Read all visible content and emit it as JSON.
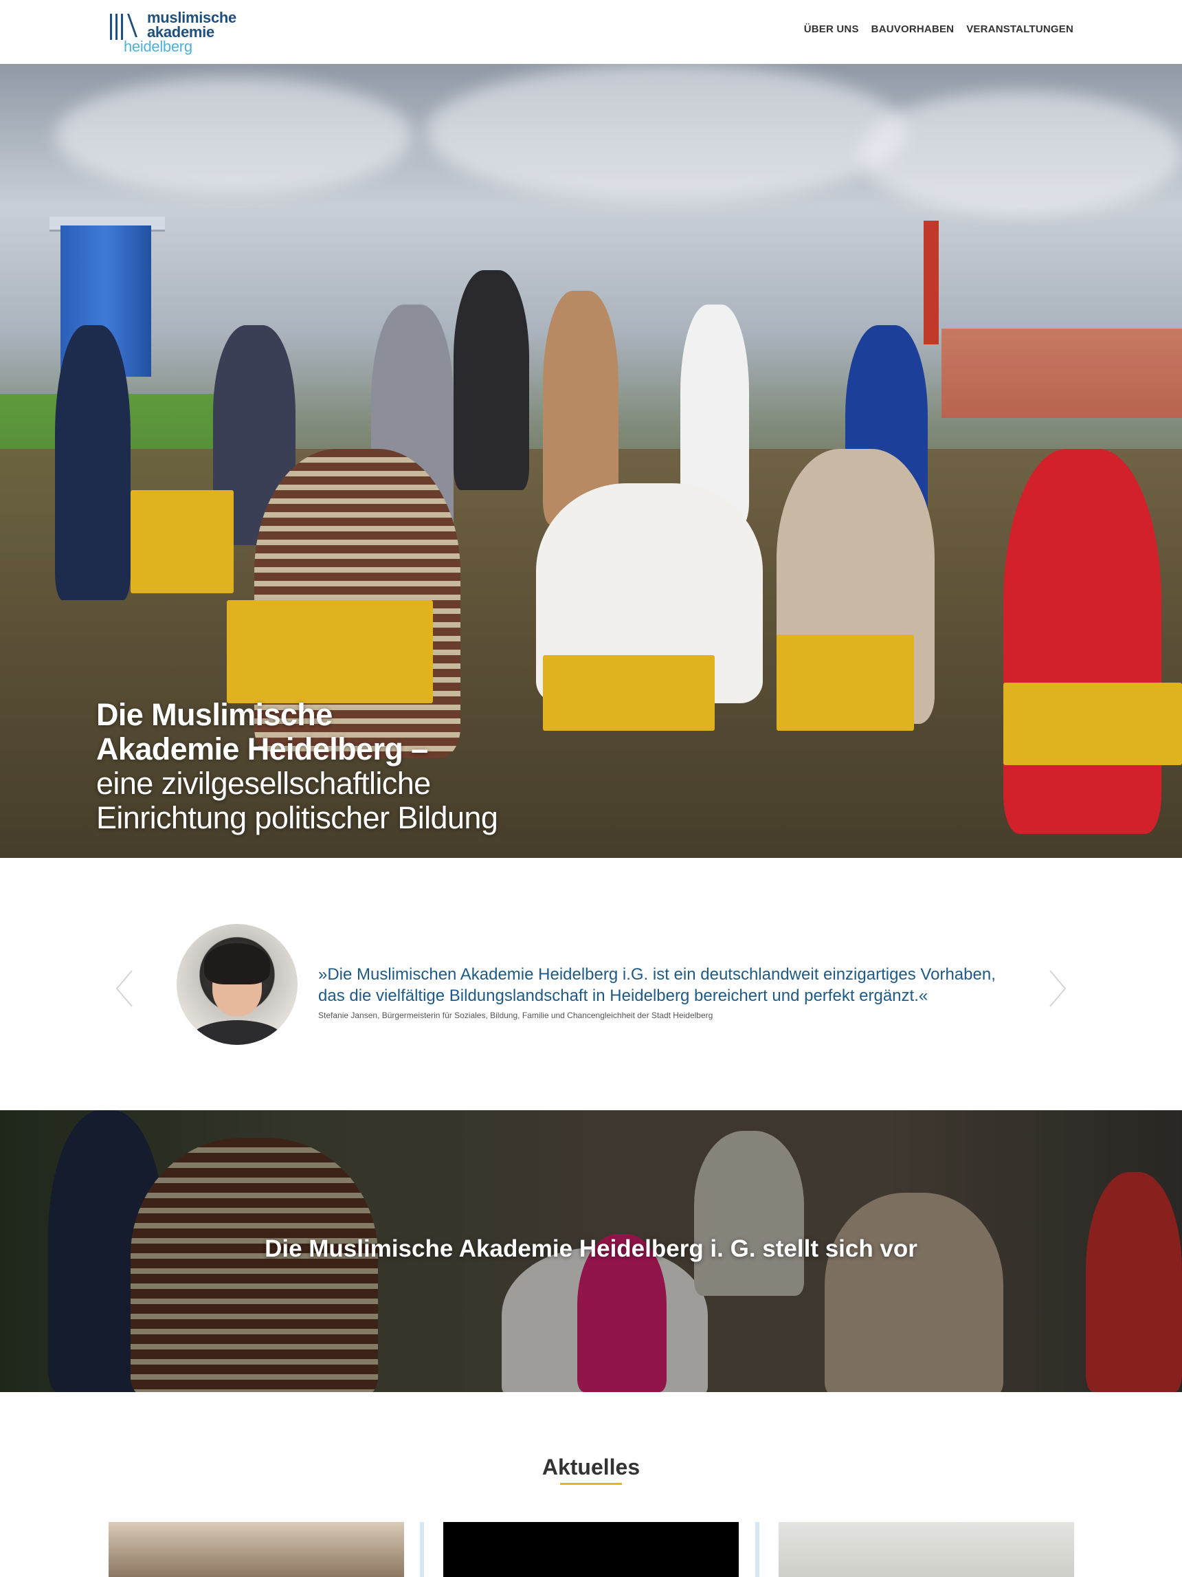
{
  "header": {
    "logo": {
      "line1": "muslimische",
      "line2": "akademie",
      "line3": "heidelberg"
    },
    "nav": [
      {
        "label": "ÜBER UNS"
      },
      {
        "label": "BAUVORHABEN"
      },
      {
        "label": "VERANSTALTUNGEN"
      }
    ]
  },
  "hero": {
    "title_bold_1": "Die Muslimische",
    "title_bold_2": "Akademie Heidelberg –",
    "title_light_1": "eine zivilgesellschaftliche",
    "title_light_2": "Einrichtung politischer Bildung"
  },
  "quote": {
    "text": "»Die Muslimischen Akademie Heidelberg i.G. ist ein deutschlandweit einzigartiges Vorhaben, das die vielfältige Bildungslandschaft in Heidelberg bereichert und perfekt ergänzt.«",
    "author": "Stefanie Jansen, Bürgermeisterin für Soziales, Bildung, Familie und Chancengleichheit der Stadt Heidelberg"
  },
  "video": {
    "title": "Die Muslimische Akademie Heidelberg i. G. stellt sich vor"
  },
  "news": {
    "heading": "Aktuelles"
  },
  "colors": {
    "brand_dark": "#1f4f7c",
    "brand_light": "#4fb1d6",
    "accent": "#e5b321"
  }
}
